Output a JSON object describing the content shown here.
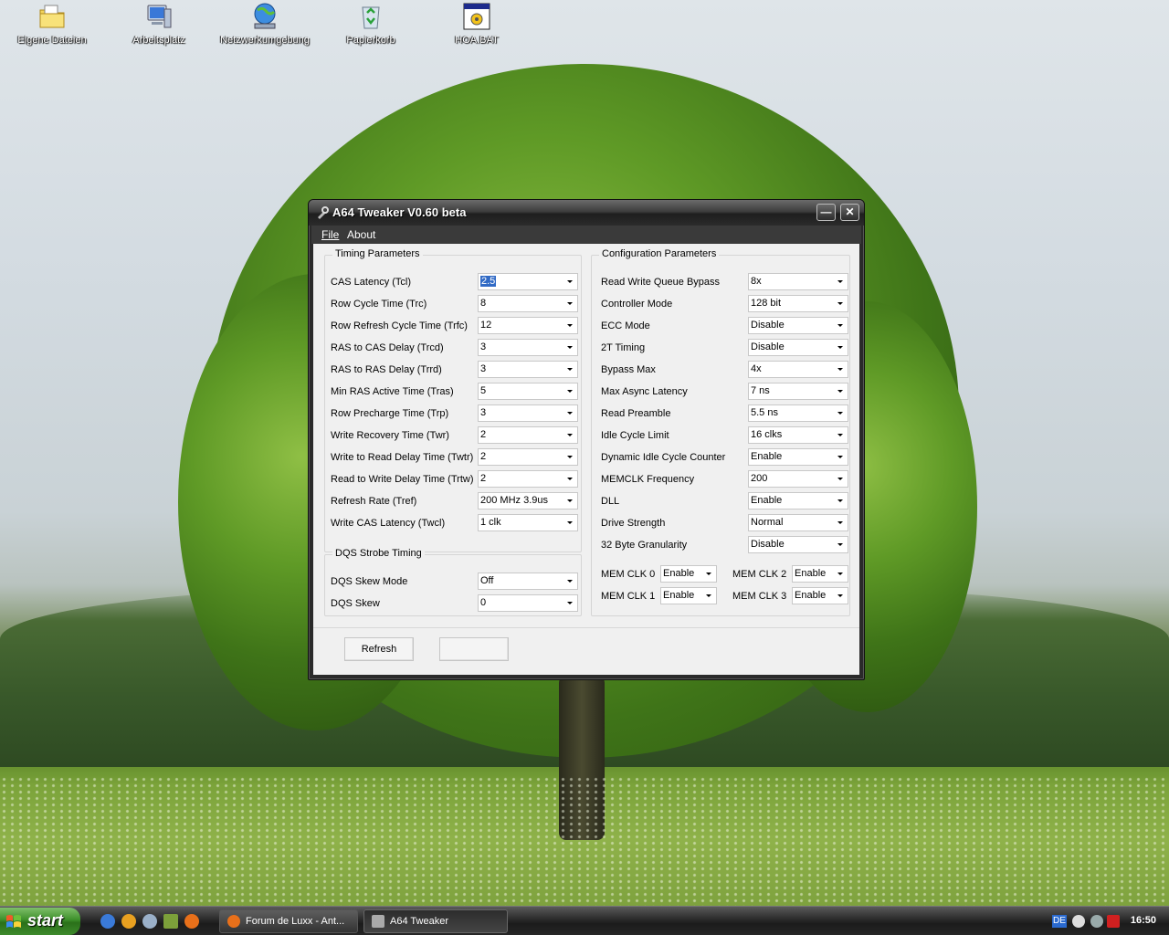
{
  "desktop": {
    "icons": [
      {
        "label": "Eigene Dateien",
        "icon": "my-documents-folder-icon"
      },
      {
        "label": "Arbeitsplatz",
        "icon": "my-computer-icon"
      },
      {
        "label": "Netzwerkumgebung",
        "icon": "network-places-icon"
      },
      {
        "label": "Papierkorb",
        "icon": "recycle-bin-icon"
      },
      {
        "label": "HOA.BAT",
        "icon": "batch-file-icon"
      }
    ]
  },
  "window": {
    "title": "A64 Tweaker V0.60 beta",
    "minimize_glyph": "—",
    "close_glyph": "✕",
    "menu": {
      "file": "File",
      "about": "About"
    },
    "timing": {
      "title": "Timing Parameters",
      "rows": [
        {
          "label": "CAS Latency (Tcl)",
          "value": "2.5"
        },
        {
          "label": "Row Cycle Time (Trc)",
          "value": "8"
        },
        {
          "label": "Row Refresh Cycle Time (Trfc)",
          "value": "12"
        },
        {
          "label": "RAS to CAS Delay (Trcd)",
          "value": "3"
        },
        {
          "label": "RAS to RAS Delay (Trrd)",
          "value": "3"
        },
        {
          "label": "Min RAS Active Time (Tras)",
          "value": "5"
        },
        {
          "label": "Row Precharge Time (Trp)",
          "value": "3"
        },
        {
          "label": "Write Recovery Time (Twr)",
          "value": "2"
        },
        {
          "label": "Write to Read Delay Time (Twtr)",
          "value": "2"
        },
        {
          "label": "Read to Write Delay Time (Trtw)",
          "value": "2"
        },
        {
          "label": "Refresh Rate (Tref)",
          "value": "200 MHz 3.9us"
        },
        {
          "label": "Write CAS Latency (Twcl)",
          "value": "1 clk"
        }
      ]
    },
    "dqs": {
      "title": "DQS Strobe Timing",
      "rows": [
        {
          "label": "DQS Skew Mode",
          "value": "Off"
        },
        {
          "label": "DQS Skew",
          "value": "0"
        }
      ]
    },
    "config": {
      "title": "Configuration Parameters",
      "rows": [
        {
          "label": "Read Write Queue Bypass",
          "value": "8x"
        },
        {
          "label": "Controller Mode",
          "value": "128 bit"
        },
        {
          "label": "ECC Mode",
          "value": "Disable"
        },
        {
          "label": "2T Timing",
          "value": "Disable"
        },
        {
          "label": "Bypass Max",
          "value": "4x"
        },
        {
          "label": "Max Async Latency",
          "value": "7 ns"
        },
        {
          "label": "Read Preamble",
          "value": "5.5 ns"
        },
        {
          "label": "Idle Cycle Limit",
          "value": "16 clks"
        },
        {
          "label": "Dynamic Idle Cycle Counter",
          "value": "Enable"
        },
        {
          "label": "MEMCLK Frequency",
          "value": "200"
        },
        {
          "label": "DLL",
          "value": "Enable"
        },
        {
          "label": "Drive Strength",
          "value": "Normal"
        },
        {
          "label": "32 Byte Granularity",
          "value": "Disable"
        }
      ],
      "memclk": [
        {
          "label": "MEM CLK 0",
          "value": "Enable"
        },
        {
          "label": "MEM CLK 2",
          "value": "Enable"
        },
        {
          "label": "MEM CLK 1",
          "value": "Enable"
        },
        {
          "label": "MEM CLK 3",
          "value": "Enable"
        }
      ]
    },
    "buttons": {
      "refresh": "Refresh",
      "apply": ""
    }
  },
  "taskbar": {
    "start": "start",
    "tasks": [
      {
        "label": "Forum de Luxx - Ant...",
        "icon": "firefox-icon"
      },
      {
        "label": "A64 Tweaker",
        "icon": "a64-tweaker-icon"
      }
    ],
    "tray": {
      "language": "DE",
      "clock": "16:50"
    }
  }
}
